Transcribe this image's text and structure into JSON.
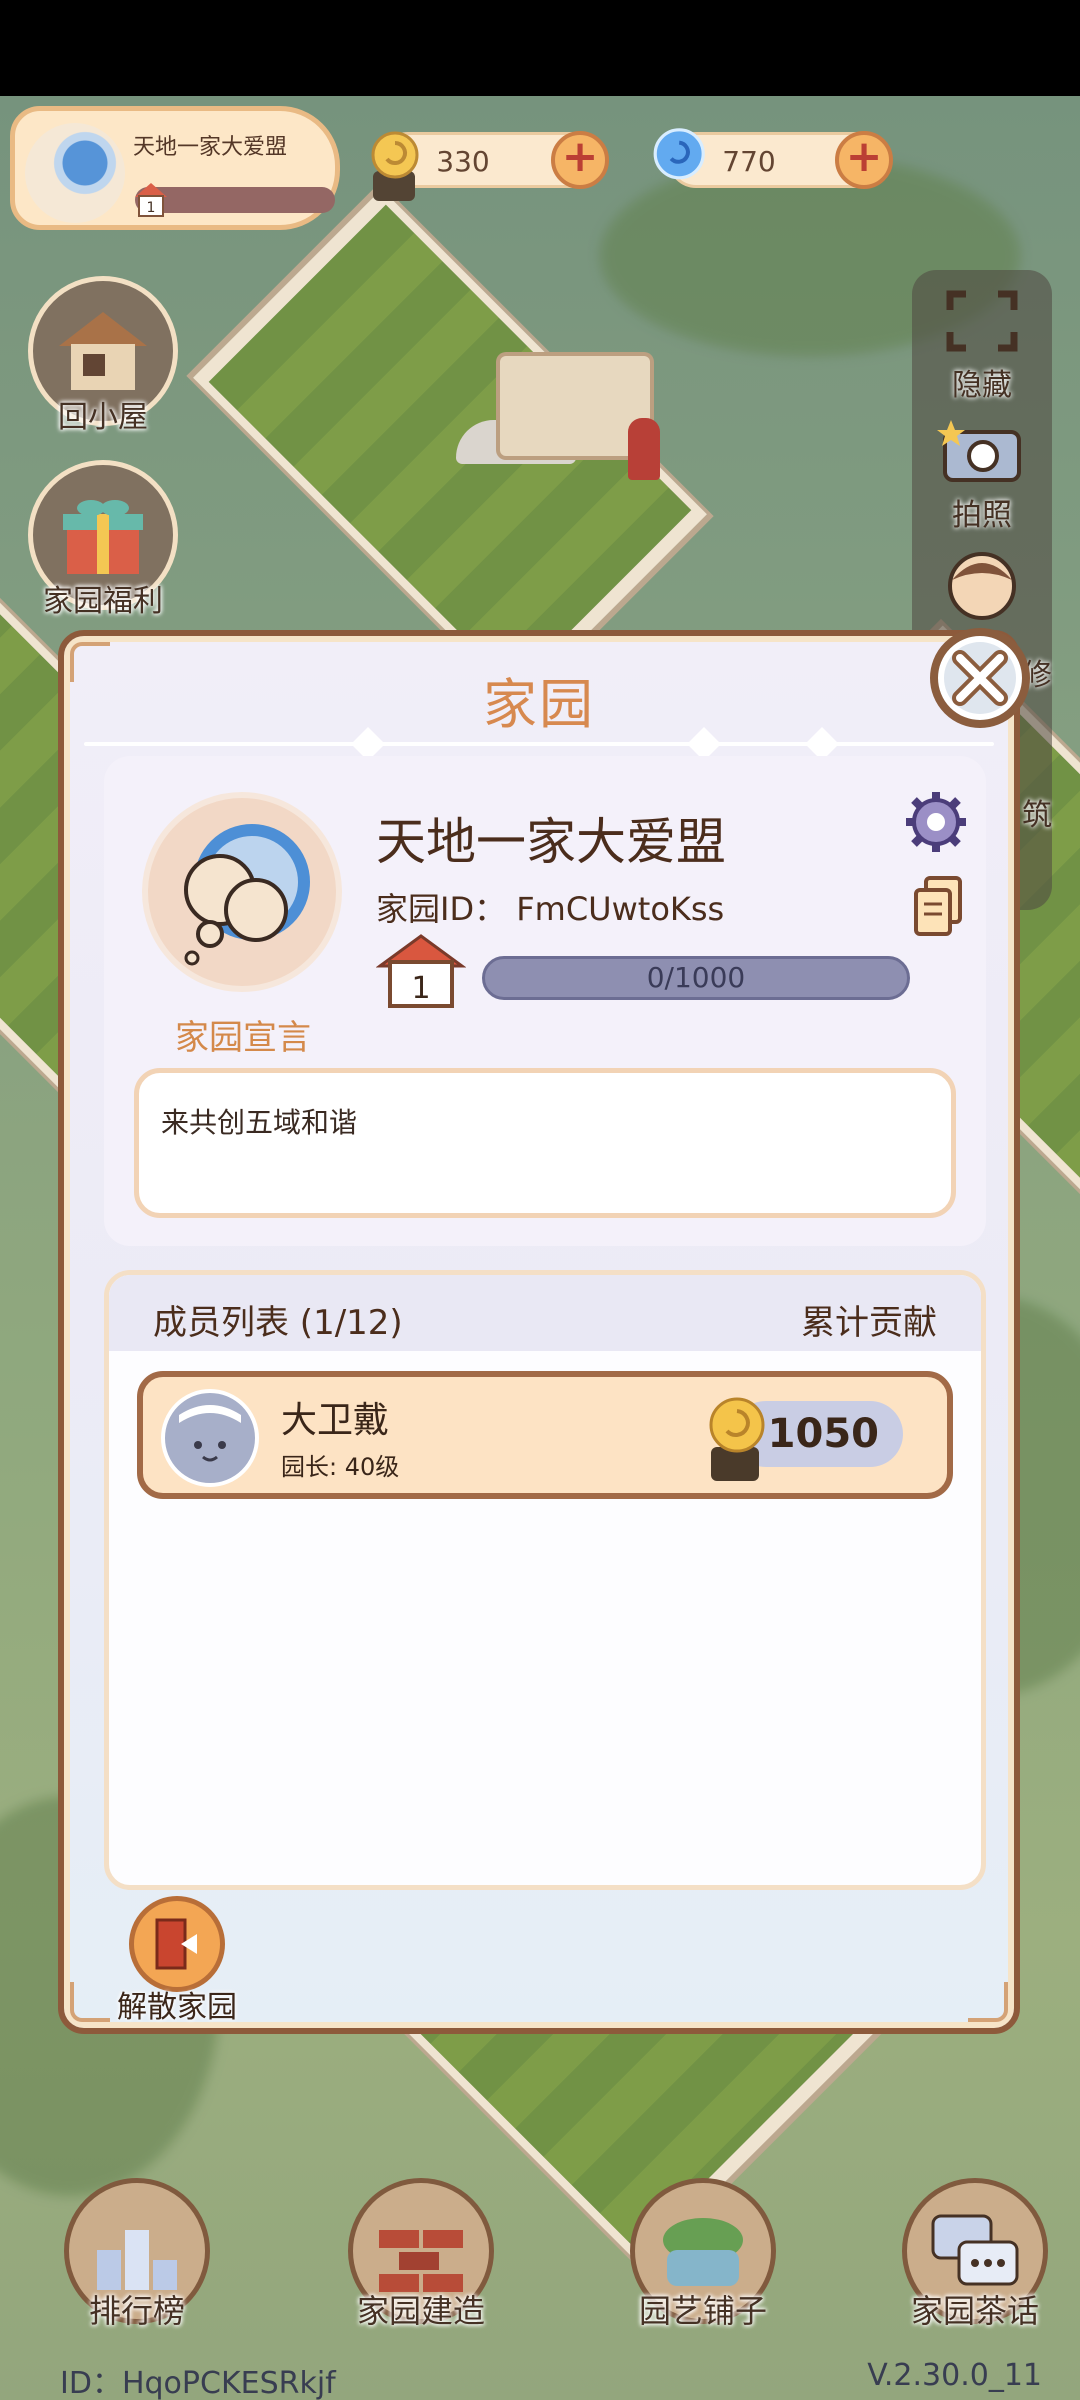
{
  "hud": {
    "home_name": "天地一家大爱盟",
    "home_level": "1",
    "currency_snail": "330",
    "currency_swirl": "770",
    "plus": "+"
  },
  "left_buttons": [
    {
      "label": "回小屋",
      "icon": "house-icon"
    },
    {
      "label": "家园福利",
      "icon": "gift-icon"
    }
  ],
  "right_toolbar": [
    {
      "label": "隐藏",
      "icon": "frame-icon"
    },
    {
      "label": "拍照",
      "icon": "camera-icon"
    },
    {
      "label": "修",
      "icon": "avatar-icon"
    },
    {
      "label": "筑",
      "icon": "build-icon"
    }
  ],
  "modal": {
    "title": "家园",
    "clan_name": "天地一家大爱盟",
    "clan_id": "家园ID：  FmCUwtoKss",
    "level": "1",
    "exp": "0/1000",
    "exp_fraction": 0,
    "declaration_label": "家园宣言",
    "declaration_text": "来共创五域和谐",
    "members_title": "成员列表 (1/12)",
    "contribution_header": "累计贡献",
    "members": [
      {
        "name": "大卫戴",
        "role": "园长: 40级",
        "contribution": "1050"
      }
    ],
    "disband_label": "解散家园"
  },
  "bottom_nav": [
    {
      "label": "排行榜",
      "icon": "ranking-icon"
    },
    {
      "label": "家园建造",
      "icon": "bricks-icon"
    },
    {
      "label": "园艺铺子",
      "icon": "flower-basket-icon"
    },
    {
      "label": "家园茶话",
      "icon": "chat-icon"
    }
  ],
  "footer": {
    "player_id": "ID：HqoPCKESRkjf",
    "version": "V.2.30.0_11"
  },
  "colors": {
    "accent_orange": "#d7894f",
    "frame_brown": "#8d5a3b",
    "exp_bar": "#8e8fb1",
    "member_row": "#fde3c4"
  }
}
